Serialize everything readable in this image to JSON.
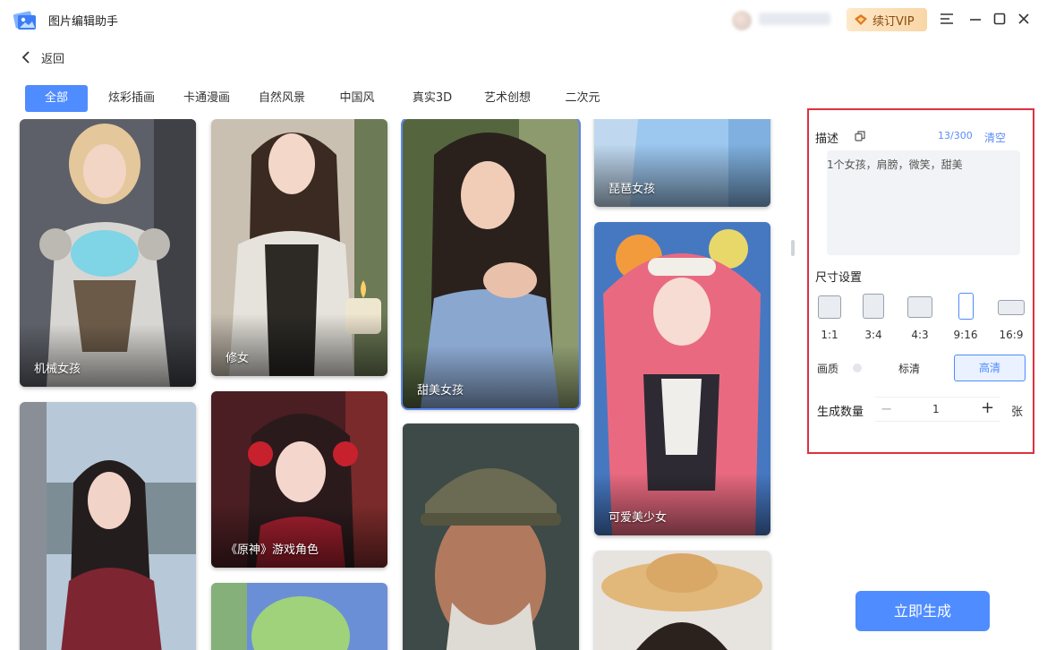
{
  "app": {
    "title": "图片编辑助手"
  },
  "header": {
    "vip_label": "续订VIP"
  },
  "nav": {
    "back_label": "返回"
  },
  "tabs": [
    {
      "label": "全部"
    },
    {
      "label": "炫彩插画"
    },
    {
      "label": "卡通漫画"
    },
    {
      "label": "自然风景"
    },
    {
      "label": "中国风"
    },
    {
      "label": "真实3D"
    },
    {
      "label": "艺术创想"
    },
    {
      "label": "二次元"
    }
  ],
  "gallery": {
    "items": [
      {
        "caption": "机械女孩"
      },
      {
        "caption": "修女"
      },
      {
        "caption": "甜美女孩"
      },
      {
        "caption": "琵琶女孩"
      },
      {
        "caption": "可爱美少女"
      },
      {
        "caption": "《原神》游戏角色"
      },
      {
        "caption": ""
      },
      {
        "caption": ""
      },
      {
        "caption": ""
      }
    ]
  },
  "panel": {
    "description_label": "描述",
    "counter": "13/300",
    "clear_label": "清空",
    "description_value": "1个女孩，肩膀，微笑，甜美",
    "size_label": "尺寸设置",
    "ratios": [
      "1:1",
      "3:4",
      "4:3",
      "9:16",
      "16:9"
    ],
    "selected_ratio": "9:16",
    "quality_label": "画质",
    "quality_standard": "标清",
    "quality_hd": "高清",
    "count_label": "生成数量",
    "count_value": "1",
    "count_unit": "张"
  },
  "generate_label": "立即生成",
  "colors": {
    "accent": "#4f8cff",
    "panel_border": "#e0303e"
  },
  "icons": {
    "back": "chevron-left-icon",
    "copy": "copy-icon",
    "help": "help-icon"
  }
}
